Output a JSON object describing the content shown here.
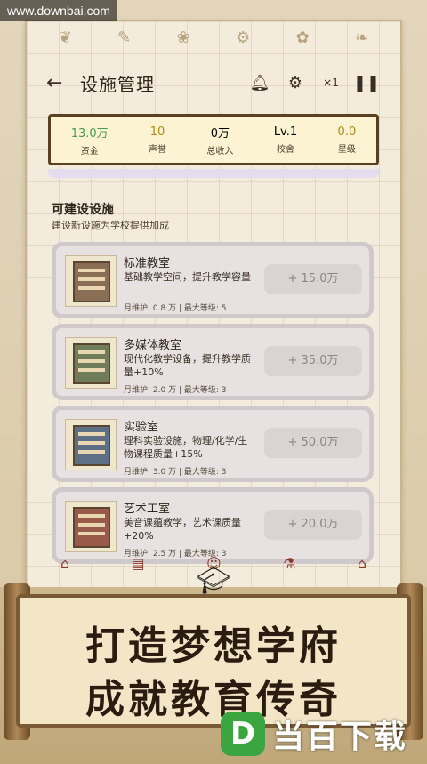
{
  "watermark": {
    "text": "www.downbai.com"
  },
  "header": {
    "title": "设施管理",
    "back_icon": "arrow-left-icon",
    "speed_label": "×1"
  },
  "stats": [
    {
      "value": "13.0万",
      "label": "资金",
      "color": "#4b9a4a"
    },
    {
      "value": "10",
      "label": "声誉",
      "color": "#b38a10"
    },
    {
      "value": "0万",
      "label": "总收入",
      "color": "#2f261c"
    },
    {
      "value": "Lv.1",
      "label": "校舍",
      "color": "#2f261c"
    },
    {
      "value": "0.0",
      "label": "星级",
      "color": "#b38a10"
    }
  ],
  "section": {
    "title": "可建设设施",
    "subtitle": "建设新设施为学校提供加成"
  },
  "facilities": [
    {
      "name": "标准教室",
      "desc": "基础教学空间，提升教学容量",
      "meta": "月维护: 0.8 万 | 最大等级: 5",
      "price": "+ 15.0万"
    },
    {
      "name": "多媒体教室",
      "desc": "现代化教学设备，提升教学质量+10%",
      "meta": "月维护: 2.0 万 | 最大等级: 3",
      "price": "+ 35.0万"
    },
    {
      "name": "实验室",
      "desc": "理科实验设施，物理/化学/生物课程质量+15%",
      "meta": "月维护: 3.0 万 | 最大等级: 3",
      "price": "+ 50.0万"
    },
    {
      "name": "艺术工室",
      "desc": "美音课蕴教学，艺术课质量+20%",
      "meta": "月维护: 2.5 万 | 最大等级: 3",
      "price": "+ 20.0万"
    }
  ],
  "banner": {
    "line1": "打造梦想学府",
    "line2": "成就教育传奇"
  },
  "logo": {
    "letter": "D",
    "text": "当百下载",
    "color": "#3ba640"
  }
}
